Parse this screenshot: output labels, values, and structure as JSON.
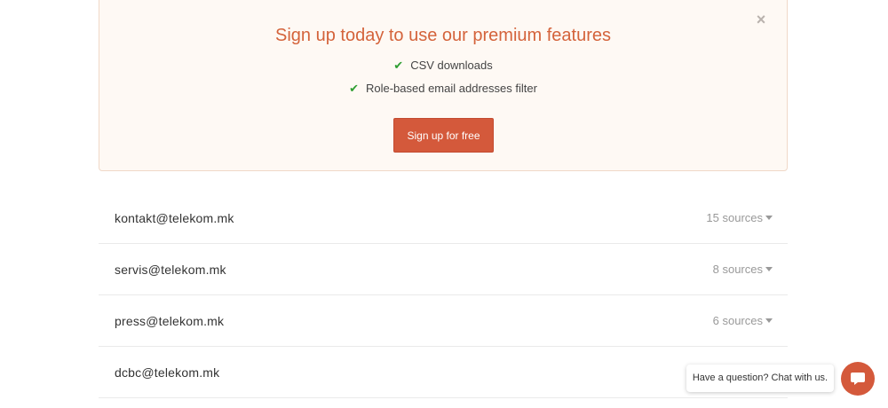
{
  "promo": {
    "title": "Sign up today to use our premium features",
    "close_icon": "close-icon",
    "features": [
      {
        "icon": "check-icon",
        "label": "CSV downloads"
      },
      {
        "icon": "check-icon",
        "label": "Role-based email addresses filter"
      }
    ],
    "signup_label": "Sign up for free",
    "colors": {
      "accent": "#d4593b",
      "title": "#d4633b",
      "check": "#2e9e31",
      "background": "#fef9f4"
    }
  },
  "emails": [
    {
      "address": "kontakt@telekom.mk",
      "sources": "15 sources"
    },
    {
      "address": "servis@telekom.mk",
      "sources": "8 sources"
    },
    {
      "address": "press@telekom.mk",
      "sources": "6 sources"
    },
    {
      "address": "dcbc@telekom.mk",
      "sources": ""
    }
  ],
  "chat": {
    "prompt": "Have a question? Chat with us.",
    "icon": "chat-icon"
  }
}
